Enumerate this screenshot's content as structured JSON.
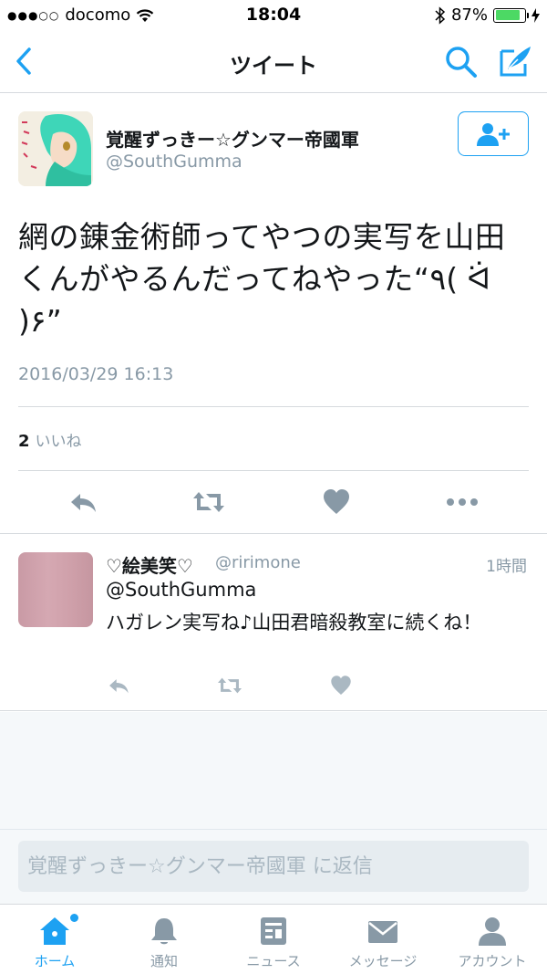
{
  "status_bar": {
    "carrier": "docomo",
    "time": "18:04",
    "battery": "87%",
    "battery_level": 0.87
  },
  "nav": {
    "title": "ツイート"
  },
  "tweet": {
    "author_name": "覚醒ずっきー☆グンマー帝國軍",
    "author_handle": "@SouthGumma",
    "text": "網の錬金術師ってやつの実写を山田くんがやるんだってねやった“٩( ᐛ )۶”",
    "timestamp": "2016/03/29 16:13",
    "like_count": "2",
    "like_label": "いいね"
  },
  "reply": {
    "name": "♡絵美笑♡",
    "handle": "@ririmone",
    "time": "1時間",
    "mention": "@SouthGumma",
    "text": "ハガレン実写ね♪山田君暗殺教室に続くね！"
  },
  "reply_box": {
    "placeholder": "覚醒ずっきー☆グンマー帝國軍 に返信"
  },
  "tabs": [
    {
      "label": "ホーム",
      "icon": "home-icon",
      "active": true
    },
    {
      "label": "通知",
      "icon": "bell-icon"
    },
    {
      "label": "ニュース",
      "icon": "news-icon"
    },
    {
      "label": "メッセージ",
      "icon": "envelope-icon"
    },
    {
      "label": "アカウント",
      "icon": "person-icon"
    }
  ],
  "colors": {
    "accent": "#1da1f2",
    "text": "#14171a",
    "muted": "#8899a6",
    "battery": "#4cd964"
  }
}
